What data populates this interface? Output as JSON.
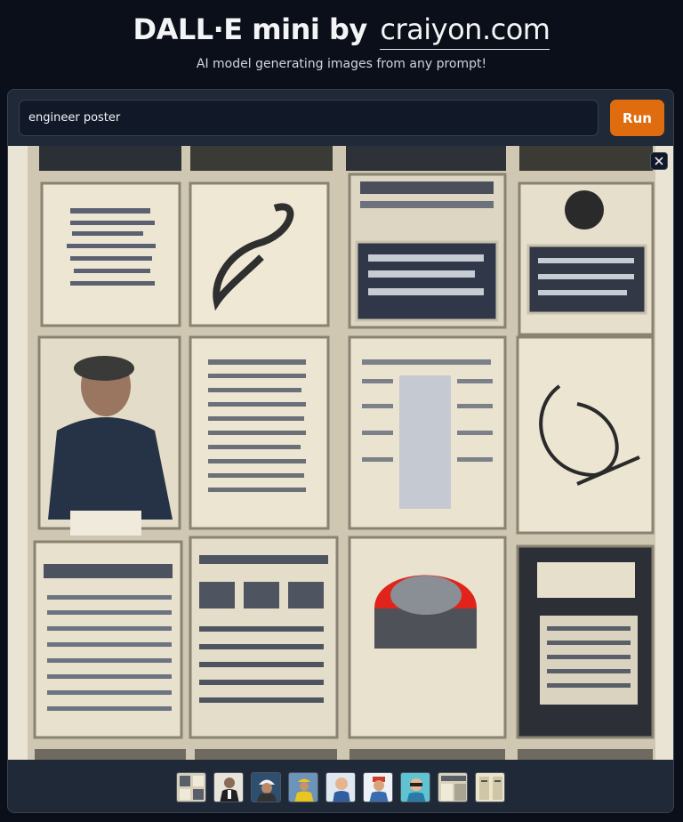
{
  "header": {
    "title_main": "DALL·E mini by",
    "title_brand": "craiyon.com",
    "subtitle": "AI model generating images from any prompt!"
  },
  "search": {
    "prompt_value": "engineer poster",
    "run_label": "Run"
  },
  "result": {
    "close_icon": "close-icon"
  },
  "thumbnails": [
    {
      "icon": "poster-grid-thumbnail"
    },
    {
      "icon": "engineer-suit-thumbnail"
    },
    {
      "icon": "engineer-helmet-thumbnail"
    },
    {
      "icon": "engineer-vest-thumbnail"
    },
    {
      "icon": "engineer-cartoon-thumbnail"
    },
    {
      "icon": "engineer-cap-thumbnail"
    },
    {
      "icon": "engineer-glasses-thumbnail"
    },
    {
      "icon": "poster-sheets-thumbnail"
    },
    {
      "icon": "poster-pages-thumbnail"
    }
  ],
  "colors": {
    "background": "#0b0f19",
    "panel": "#1f2937",
    "accent": "#e06c10"
  }
}
